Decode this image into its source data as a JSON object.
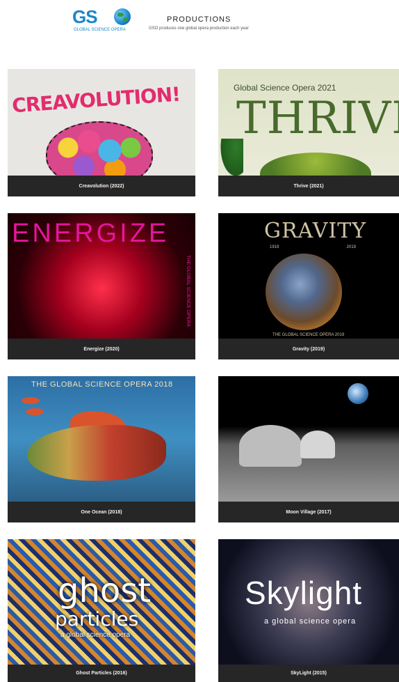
{
  "header": {
    "logo_letters": "GS",
    "logo_sub": "GLOBAL SCIENCE OPERA",
    "title": "PRODUCTIONS",
    "subtitle": "GSO produces one global opera production each year"
  },
  "productions": [
    {
      "caption": "Creavolution (2022)",
      "art": {
        "headline": "CREAVOLUTION!"
      }
    },
    {
      "caption": "Thrive (2021)",
      "art": {
        "topline": "Global Science Opera 2021",
        "headline": "THRIVE"
      }
    },
    {
      "caption": "Energize (2020)",
      "art": {
        "headline": "ENERGIZE",
        "sideline": "THE GLOBAL SCIENCE OPERA"
      }
    },
    {
      "caption": "Gravity (2019)",
      "art": {
        "headline": "GRAVITY",
        "year_left": "1919",
        "year_right": "2019",
        "bottomline": "THE GLOBAL SCIENCE OPERA 2019"
      }
    },
    {
      "caption": "One Ocean (2018)",
      "art": {
        "topline": "THE GLOBAL SCIENCE OPERA 2018"
      }
    },
    {
      "caption": "Moon Village (2017)",
      "art": {}
    },
    {
      "caption": "Ghost Particles (2016)",
      "art": {
        "line1": "ghost",
        "line2": "particles",
        "line3": "a global science opera"
      }
    },
    {
      "caption": "SkyLight (2015)",
      "art": {
        "line1": "Skylight",
        "line2": "a global science opera"
      }
    }
  ]
}
